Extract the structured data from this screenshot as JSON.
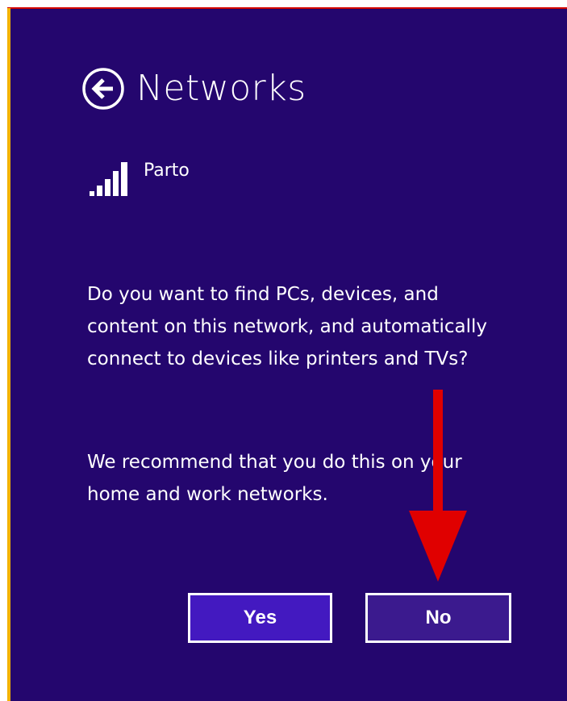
{
  "panel": {
    "title": "Networks",
    "back_icon": "back-arrow-circle-icon",
    "network": {
      "name": "Parto",
      "icon": "wifi-signal-bars-icon",
      "signal_bars": 5
    },
    "question": "Do you want to find PCs, devices, and content on this network, and automatically connect to devices like printers and TVs?",
    "recommendation": "We recommend that you do this on your home and work networks.",
    "buttons": {
      "yes_label": "Yes",
      "no_label": "No"
    }
  },
  "annotation": {
    "arrow_icon": "red-down-arrow-icon",
    "arrow_color": "#e00000"
  },
  "colors": {
    "panel_background": "#24066e",
    "accent_bar": "#f2b200",
    "yes_button": "#4319c0",
    "no_button": "#3b1a8e"
  }
}
